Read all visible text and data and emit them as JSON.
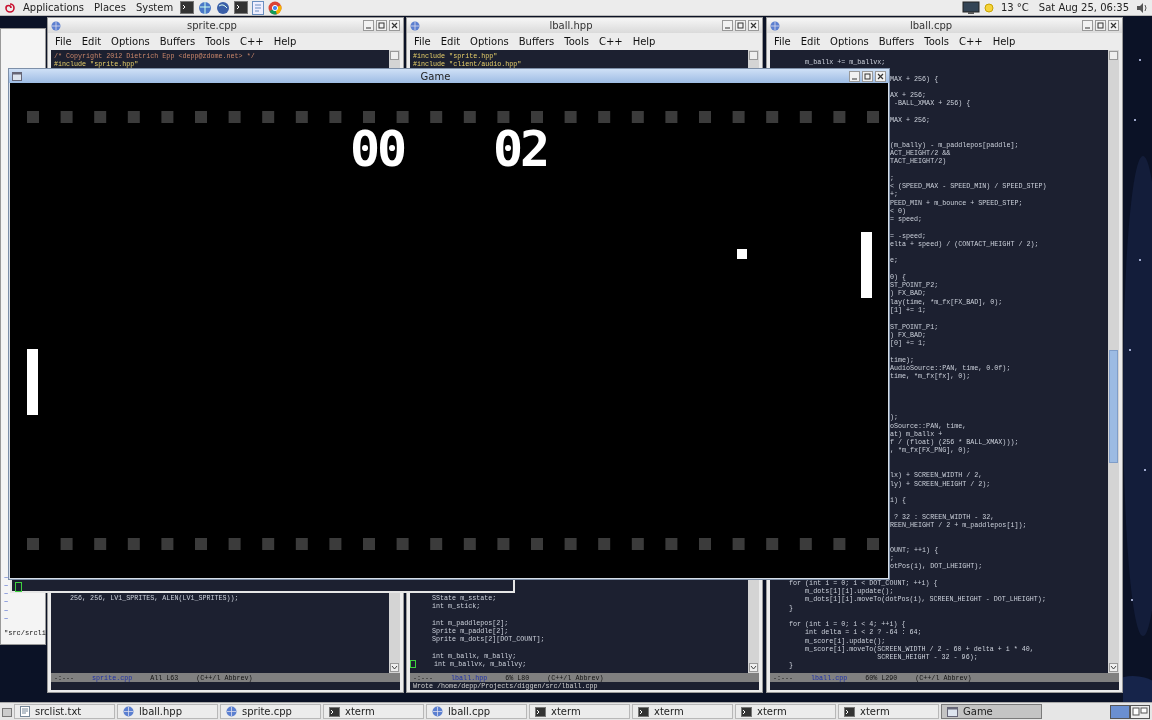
{
  "top_panel": {
    "menus": [
      "Applications",
      "Places",
      "System"
    ],
    "weather": "13 °C",
    "clock": "Sat Aug 25, 06:35"
  },
  "xterm": {
    "lines": [
      "~",
      "~",
      "~",
      "~",
      "~",
      "~"
    ],
    "status": "\"src/srcli"
  },
  "editors": [
    {
      "title": "sprite.cpp",
      "menu": [
        "File",
        "Edit",
        "Options",
        "Buffers",
        "Tools",
        "C++",
        "Help"
      ],
      "top_lines": [
        {
          "kind": "comment",
          "text": "/* Copyright 2012 Dietrich Epp <depp@zdome.net> */"
        },
        {
          "kind": "preproc",
          "text": "#include \"sprite.hpp\""
        }
      ],
      "lines": [
        {
          "kind": "code",
          "text": "    256, 256, LV1_SPRITES, ALEN(LV1_SPRITES));"
        }
      ],
      "mode_line": {
        "flags": "-:---",
        "buffer": "sprite.cpp",
        "position": "All L63",
        "mode": "(C++/l Abbrev)"
      }
    },
    {
      "title": "lball.hpp",
      "menu": [
        "File",
        "Edit",
        "Options",
        "Buffers",
        "Tools",
        "C++",
        "Help"
      ],
      "top_lines": [
        {
          "kind": "preproc",
          "text": "#include \"sprite.hpp\""
        },
        {
          "kind": "preproc",
          "text": "#include \"client/audio.hpp\""
        }
      ],
      "lines": [
        {
          "kind": "code",
          "cursor": false,
          "text": "    SState m_sstate;"
        },
        {
          "kind": "code",
          "cursor": false,
          "text": "    int m_stick;"
        },
        {
          "kind": "blank",
          "cursor": false
        },
        {
          "kind": "code",
          "cursor": false,
          "text": "    int m_paddlepos[2];"
        },
        {
          "kind": "code",
          "cursor": false,
          "text": "    Sprite m_paddle[2];"
        },
        {
          "kind": "code",
          "cursor": false,
          "text": "    Sprite m_dots[2][DOT_COUNT];"
        },
        {
          "kind": "blank",
          "cursor": false
        },
        {
          "kind": "code",
          "cursor": false,
          "text": "    int m_ballx, m_bally;"
        },
        {
          "kind": "code",
          "cursor": true,
          "text": "    int m_ballvx, m_ballvy;"
        }
      ],
      "mode_line": {
        "flags": "-:---",
        "buffer": "lball.hpp",
        "position": "6% L80",
        "mode": "(C++/l Abbrev)"
      },
      "echo": "Wrote /home/depp/Projects/diggen/src/lball.cpp"
    },
    {
      "title": "lball.cpp",
      "menu": [
        "File",
        "Edit",
        "Options",
        "Buffers",
        "Tools",
        "C++",
        "Help"
      ],
      "lines": [
        {
          "kind": "code",
          "text": "        m_ballx += m_ballvx;"
        },
        {
          "kind": "blank"
        },
        {
          "kind": "clip",
          "text": "MAX + 256) {"
        },
        {
          "kind": "blank"
        },
        {
          "kind": "clip",
          "text": "AX + 256;"
        },
        {
          "kind": "clip",
          "text": " -BALL_XMAX + 256) {"
        },
        {
          "kind": "blank"
        },
        {
          "kind": "clip",
          "text": "MAX + 256;"
        },
        {
          "kind": "blank"
        },
        {
          "kind": "blank"
        },
        {
          "kind": "clip",
          "text": "(m_bally) - m_paddlepos[paddle];"
        },
        {
          "kind": "clip",
          "text": "ACT_HEIGHT/2 &&"
        },
        {
          "kind": "clip",
          "text": "TACT_HEIGHT/2)"
        },
        {
          "kind": "blank"
        },
        {
          "kind": "clip",
          "text": ";"
        },
        {
          "kind": "clip",
          "text": "< (SPEED_MAX - SPEED_MIN) / SPEED_STEP)"
        },
        {
          "kind": "clip",
          "text": "+;"
        },
        {
          "kind": "clip",
          "text": "PEED_MIN + m_bounce + SPEED_STEP;"
        },
        {
          "kind": "clip",
          "text": "< 0)"
        },
        {
          "kind": "clip",
          "text": "= speed;"
        },
        {
          "kind": "blank"
        },
        {
          "kind": "clip",
          "text": "= -speed;"
        },
        {
          "kind": "clip",
          "text": "elta + speed) / (CONTACT_HEIGHT / 2);"
        },
        {
          "kind": "blank"
        },
        {
          "kind": "clip",
          "text": "e;"
        },
        {
          "kind": "blank"
        },
        {
          "kind": "clip",
          "text": "0) {"
        },
        {
          "kind": "clip",
          "text": "ST_POINT_P2;"
        },
        {
          "kind": "clip",
          "text": ") FX_BAD;"
        },
        {
          "kind": "clip",
          "text": "lay(time, *m_fx[FX_BAD], 0);"
        },
        {
          "kind": "clip",
          "text": "[1] += 1;"
        },
        {
          "kind": "blank"
        },
        {
          "kind": "clip",
          "text": "ST_POINT_P1;"
        },
        {
          "kind": "clip",
          "text": ") FX_BAD;"
        },
        {
          "kind": "clip",
          "text": "[0] += 1;"
        },
        {
          "kind": "blank"
        },
        {
          "kind": "clip",
          "text": "time);"
        },
        {
          "kind": "clip",
          "text": "AudioSource::PAN, time, 0.0f);"
        },
        {
          "kind": "clip",
          "text": "time, *m_fx[fx], 0);"
        },
        {
          "kind": "blank"
        },
        {
          "kind": "blank"
        },
        {
          "kind": "blank"
        },
        {
          "kind": "blank"
        },
        {
          "kind": "clip",
          "text": ");"
        },
        {
          "kind": "clip",
          "text": "oSource::PAN, time,"
        },
        {
          "kind": "clip",
          "text": "at) m_ballx +"
        },
        {
          "kind": "clip",
          "text": "f / (float) (256 * BALL_XMAX)));"
        },
        {
          "kind": "clip",
          "text": ", *m_fx[FX_PNG], 0);"
        },
        {
          "kind": "blank"
        },
        {
          "kind": "blank"
        },
        {
          "kind": "clip",
          "text": "lx) + SCREEN_WIDTH / 2,"
        },
        {
          "kind": "clip",
          "text": "ly) + SCREEN_HEIGHT / 2);"
        },
        {
          "kind": "blank"
        },
        {
          "kind": "clip",
          "text": "i) {"
        },
        {
          "kind": "blank"
        },
        {
          "kind": "clip",
          "text": " ? 32 : SCREEN_WIDTH - 32,"
        },
        {
          "kind": "clip",
          "text": "REEN_HEIGHT / 2 + m_paddlepos[i]);"
        },
        {
          "kind": "blank"
        },
        {
          "kind": "blank"
        },
        {
          "kind": "clip",
          "text": "OUNT; ++i) {"
        },
        {
          "kind": "clip",
          "text": ";"
        },
        {
          "kind": "clip",
          "text": "otPos(i), DOT_LHEIGHT);"
        },
        {
          "kind": "blank"
        },
        {
          "kind": "code",
          "text": "    for (int i = 0; i < DOT_COUNT; ++i) {"
        },
        {
          "kind": "code",
          "text": "        m_dots[1][i].update();"
        },
        {
          "kind": "code",
          "text": "        m_dots[1][i].moveTo(dotPos(i), SCREEN_HEIGHT - DOT_LHEIGHT);"
        },
        {
          "kind": "code",
          "text": "    }"
        },
        {
          "kind": "blank"
        },
        {
          "kind": "code",
          "text": "    for (int i = 0; i < 4; ++i) {"
        },
        {
          "kind": "code",
          "text": "        int delta = i < 2 ? -64 : 64;"
        },
        {
          "kind": "code",
          "text": "        m_score[i].update();"
        },
        {
          "kind": "code",
          "text": "        m_score[i].moveTo(SCREEN_WIDTH / 2 - 60 + delta + i * 40,"
        },
        {
          "kind": "code",
          "text": "                          SCREEN_HEIGHT - 32 - 96);"
        },
        {
          "kind": "code",
          "text": "    }"
        }
      ],
      "mode_line": {
        "flags": "-:---",
        "buffer": "lball.cpp",
        "position": "60% L290",
        "mode": "(C++/l Abbrev)"
      }
    }
  ],
  "game": {
    "title": "Game",
    "scores": [
      "00",
      "02"
    ]
  },
  "taskbar": [
    {
      "label": "srclist.txt",
      "kind": "text",
      "selected": false
    },
    {
      "label": "lball.hpp",
      "kind": "emacs",
      "selected": false
    },
    {
      "label": "sprite.cpp",
      "kind": "emacs",
      "selected": false
    },
    {
      "label": "xterm",
      "kind": "terminal",
      "selected": false
    },
    {
      "label": "lball.cpp",
      "kind": "emacs",
      "selected": false
    },
    {
      "label": "xterm",
      "kind": "terminal",
      "selected": false
    },
    {
      "label": "xterm",
      "kind": "terminal",
      "selected": false
    },
    {
      "label": "xterm",
      "kind": "terminal",
      "selected": false
    },
    {
      "label": "xterm",
      "kind": "terminal",
      "selected": false
    },
    {
      "label": "Game",
      "kind": "window",
      "selected": true
    }
  ]
}
